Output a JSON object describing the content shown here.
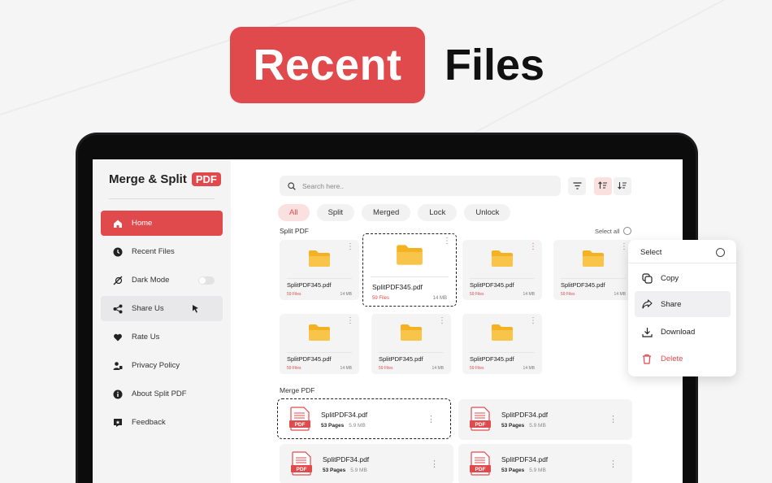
{
  "banner": {
    "highlight": "Recent",
    "rest": "Files"
  },
  "sidebar": {
    "brand_name": "Merge & Split",
    "brand_tag": "PDF",
    "items": [
      {
        "label": "Home",
        "icon": "home-icon"
      },
      {
        "label": "Recent Files",
        "icon": "clock-icon"
      },
      {
        "label": "Dark Mode",
        "icon": "dark-mode-icon"
      },
      {
        "label": "Share Us",
        "icon": "share-icon"
      },
      {
        "label": "Rate Us",
        "icon": "heart-icon"
      },
      {
        "label": "Privacy Policy",
        "icon": "privacy-icon"
      },
      {
        "label": "About Split PDF",
        "icon": "info-icon"
      },
      {
        "label": "Feedback",
        "icon": "feedback-icon"
      }
    ]
  },
  "search": {
    "placeholder": "Search here.."
  },
  "filters": [
    "All",
    "Split",
    "Merged",
    "Lock",
    "Unlock"
  ],
  "split_section": {
    "label": "Split PDF",
    "select_all": "Select all",
    "folders": [
      {
        "name": "SplitPDF345.pdf",
        "files": "59 Files",
        "size": "14 MB"
      },
      {
        "name": "SplitPDF345.pdf",
        "files": "59 Files",
        "size": "14 MB"
      },
      {
        "name": "SplitPDF345.pdf",
        "files": "59 Files",
        "size": "14 MB"
      },
      {
        "name": "SplitPDF345.pdf",
        "files": "59 Files",
        "size": "14 MB"
      },
      {
        "name": "SplitPDF345.pdf",
        "files": "59 Files",
        "size": "14 MB"
      },
      {
        "name": "SplitPDF345.pdf",
        "files": "59 Files",
        "size": "14 MB"
      },
      {
        "name": "SplitPDF345.pdf",
        "files": "59 Files",
        "size": "14 MB"
      }
    ]
  },
  "merge_section": {
    "label": "Merge PDF",
    "files": [
      {
        "name": "SplitPDF34.pdf",
        "pages": "53 Pages",
        "size": "5.9 MB",
        "badge": "PDF"
      },
      {
        "name": "SplitPDF34.pdf",
        "pages": "53 Pages",
        "size": "5.9 MB",
        "badge": "PDF"
      },
      {
        "name": "SplitPDF34.pdf",
        "pages": "53 Pages",
        "size": "5.9 MB",
        "badge": "PDF"
      },
      {
        "name": "SplitPDF34.pdf",
        "pages": "53 Pages",
        "size": "5.9 MB",
        "badge": "PDF"
      }
    ]
  },
  "context_menu": {
    "title": "Select",
    "items": [
      {
        "label": "Copy",
        "icon": "copy-icon"
      },
      {
        "label": "Share",
        "icon": "share-arrow-icon"
      },
      {
        "label": "Download",
        "icon": "download-icon"
      },
      {
        "label": "Delete",
        "icon": "trash-icon"
      }
    ]
  },
  "colors": {
    "accent": "#e04a4d",
    "folder": "#f4b223"
  }
}
